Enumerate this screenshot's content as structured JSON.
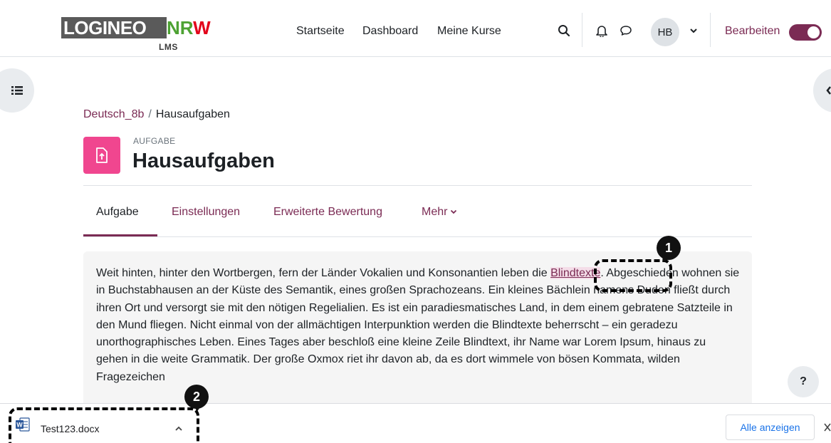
{
  "brand": {
    "logo_main": "LOGINEO",
    "logo_nr": "NR",
    "logo_w": "W",
    "logo_sub": "LMS"
  },
  "nav": {
    "links": [
      "Startseite",
      "Dashboard",
      "Meine Kurse"
    ],
    "user_initials": "HB",
    "edit_label": "Bearbeiten",
    "edit_mode_on": true
  },
  "breadcrumb": {
    "course": "Deutsch_8b",
    "separator": "/",
    "current": "Hausaufgaben"
  },
  "activity": {
    "type": "AUFGABE",
    "title": "Hausaufgaben"
  },
  "tabs": [
    "Aufgabe",
    "Einstellungen",
    "Erweiterte Bewertung",
    "Mehr"
  ],
  "content": {
    "text_before": "Weit hinten, hinter den Wortbergen, fern der Länder Vokalien und Konsonantien leben die ",
    "link": "Blindtexte",
    "text_after": ". Abgeschieden wohnen sie in Buchstabhausen an der Küste des Semantik, eines großen Sprachozeans. Ein kleines Bächlein namens Duden fließt durch ihren Ort und versorgt sie mit den nötigen Regelialien. Es ist ein paradiesmatisches Land, in dem einem gebratene Satzteile in den Mund fliegen. Nicht einmal von der allmächtigen Interpunktion werden die Blindtexte beherrscht – ein geradezu unorthographisches Leben. Eines Tages aber beschloß eine kleine Zeile Blindtext, ihr Name war Lorem Ipsum, hinaus zu gehen in die weite Grammatik. Der große Oxmox riet ihr davon ab, da es dort wimmele von bösen Kommata, wilden Fragezeichen"
  },
  "callouts": [
    "1",
    "2"
  ],
  "help": "?",
  "downloads": {
    "file_name": "Test123.docx",
    "show_all": "Alle anzeigen"
  },
  "colors": {
    "accent": "#7b2b54",
    "activity_icon": "#f0468f",
    "link_highlight": "#f4dde8"
  }
}
